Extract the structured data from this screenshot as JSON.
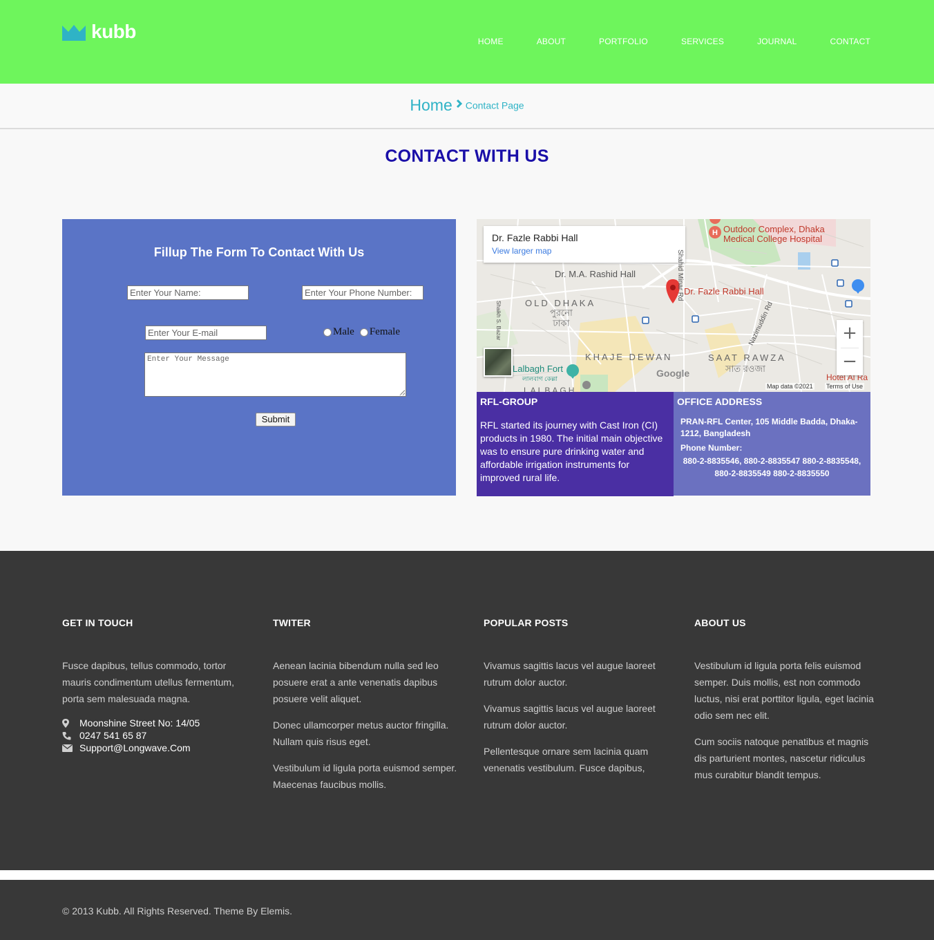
{
  "brand": {
    "name": "kubb",
    "logo_icon": "crown-icon",
    "colors": {
      "header_bg": "#6ef55c",
      "accent": "#2fb3c6",
      "title": "#1a0fa8",
      "form_bg": "#5a74c6",
      "rfl_bg": "#4a2fa3",
      "office_bg": "#6b71c0",
      "footer_bg": "#383838"
    }
  },
  "nav": {
    "items": [
      "HOME",
      "ABOUT",
      "PORTFOLIO",
      "SERVICES",
      "JOURNAL",
      "CONTACT"
    ]
  },
  "breadcrumb": {
    "home": "Home",
    "separator_icon": "chevron-right-icon",
    "current": "Contact Page"
  },
  "page": {
    "title": "CONTACT WITH US"
  },
  "form": {
    "title": "Fillup The Form To Contact With Us",
    "name_placeholder": "Enter Your Name:",
    "phone_placeholder": "Enter Your Phone Number:",
    "email_placeholder": "Enter Your E-mail",
    "gender_options": [
      "Male",
      "Female"
    ],
    "message_placeholder": "Enter Your Message",
    "submit_label": "Submit"
  },
  "map": {
    "place_title": "Dr. Fazle Rabbi Hall",
    "view_larger": "View larger map",
    "labels": {
      "outdoor_complex_1": "Outdoor Complex, Dhaka",
      "outdoor_complex_2": "Medical College Hospital",
      "rashid_hall": "Dr. M.A. Rashid Hall",
      "pin_label": "Dr. Fazle Rabbi Hall",
      "old_dhaka": "OLD DHAKA",
      "old_dhaka_bn_1": "পুরনো",
      "old_dhaka_bn_2": "ঢাকা",
      "khaje_dewan": "KHAJE DEWAN",
      "saat_rawza": "SAAT RAWZA",
      "saat_rawza_bn": "সাত রওজা",
      "lalbagh_fort": "Lalbagh Fort",
      "lalbagh_fort_bn": "লালবাগ কেল্লা",
      "lalbagh": "LALBAGH",
      "shahid_minar_rd": "Shahid Minar Rd",
      "nazimuddin_rd": "Nazimuddin Rd",
      "shaikh_bazar": "Shaikh S. Bazar",
      "hotel": "Hotel Al Ra",
      "google": "Google",
      "map_data": "Map data ©2021",
      "terms": "Terms of Use"
    },
    "zoom_in": "+",
    "zoom_out": "−"
  },
  "rfl": {
    "title": "RFL-GROUP",
    "text": "RFL started its journey with Cast Iron (CI) products in 1980. The initial main objective was to ensure pure drinking water and affordable irrigation instruments for improved rural life."
  },
  "office": {
    "title": "OFFICE ADDRESS",
    "address": "PRAN-RFL Center, 105 Middle Badda, Dhaka-1212, Bangladesh",
    "phone_label": "Phone Number:",
    "phones_line1": "880-2-8835546, 880-2-8835547 880-2-8835548,",
    "phones_line2": "880-2-8835549 880-2-8835550"
  },
  "footer": {
    "get_in_touch": {
      "title": "GET IN TOUCH",
      "text": "Fusce dapibus, tellus commodo, tortor mauris condimentum utellus fermentum, porta sem malesuada magna.",
      "address": "Moonshine Street No: 14/05",
      "phone": "0247 541 65 87",
      "email": "Support@Longwave.Com"
    },
    "twitter": {
      "title": "TWITER",
      "paragraphs": [
        "Aenean lacinia bibendum nulla sed leo posuere erat a ante venenatis dapibus posuere velit aliquet.",
        "Donec ullamcorper metus auctor fringilla. Nullam quis risus eget.",
        "Vestibulum id ligula porta euismod semper. Maecenas faucibus mollis."
      ]
    },
    "popular_posts": {
      "title": "POPULAR POSTS",
      "paragraphs": [
        "Vivamus sagittis lacus vel augue laoreet rutrum dolor auctor.",
        "Vivamus sagittis lacus vel augue laoreet rutrum dolor auctor.",
        "Pellentesque ornare sem lacinia quam venenatis vestibulum. Fusce dapibus,"
      ]
    },
    "about_us": {
      "title": "ABOUT US",
      "paragraphs": [
        "Vestibulum id ligula porta felis euismod semper. Duis mollis, est non commodo luctus, nisi erat porttitor ligula, eget lacinia odio sem nec elit.",
        "Cum sociis natoque penatibus et magnis dis parturient montes, nascetur ridiculus mus curabitur blandit tempus."
      ]
    },
    "copyright": "© 2013 Kubb. All Rights Reserved. Theme By Elemis."
  }
}
